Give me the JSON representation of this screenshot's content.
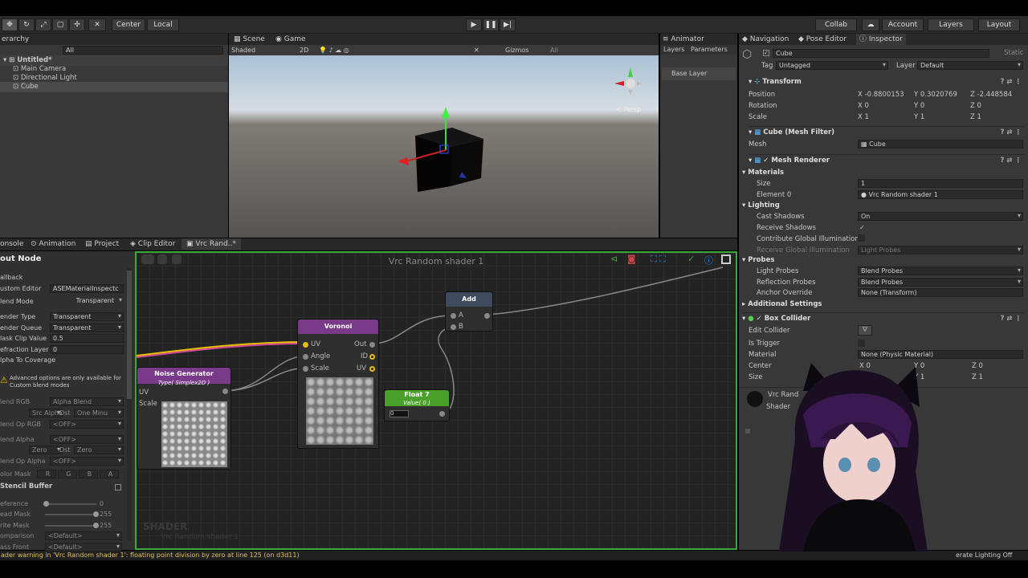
{
  "toolbar": {
    "pivot": "Center",
    "space": "Local",
    "collab": "Collab",
    "account": "Account",
    "layers": "Layers",
    "layout": "Layout"
  },
  "hierarchy": {
    "tab": "erarchy",
    "search": "All",
    "scene": "Untitled*",
    "items": [
      "Main Camera",
      "Directional Light",
      "Cube"
    ]
  },
  "scene": {
    "tabs": [
      "Scene",
      "Game"
    ],
    "shading": "Shaded",
    "mode2d": "2D",
    "gizmos": "Gizmos",
    "search": "All",
    "persp": "< Persp"
  },
  "animator": {
    "tab": "Animator",
    "sub_tabs": [
      "Layers",
      "Parameters"
    ],
    "layer": "Base Layer"
  },
  "bottom_tabs": [
    "onsole",
    "Animation",
    "Project",
    "Clip Editor",
    "Vrc Rand..*"
  ],
  "output_node": {
    "title": "out Node",
    "rows": [
      {
        "l": "allback",
        "v": ""
      },
      {
        "l": "ustom Editor",
        "v": "ASEMaterialInspectc"
      },
      {
        "l": "lend Mode",
        "v": "Transparent"
      },
      {
        "l": "ender Type",
        "v": "Transparent"
      },
      {
        "l": "ender Queue",
        "v": "Transparent"
      },
      {
        "l": "lask Clip Value",
        "v": "0.5"
      },
      {
        "l": "efraction Layer",
        "v": "0"
      },
      {
        "l": "lpha To Coverage",
        "v": ""
      }
    ],
    "warning": "Advanced options are only available for Custom blend modes",
    "blend_rows": [
      {
        "l": "lend RGB",
        "v": "Alpha Blend"
      },
      {
        "l": "Src",
        "v": "Src Alpha"
      },
      {
        "l": "Dst",
        "v": "One Minu"
      },
      {
        "l": "lend Op RGB",
        "v": "<OFF>"
      },
      {
        "l": "lend Alpha",
        "v": "<OFF>"
      },
      {
        "l": "Src",
        "v": "Zero"
      },
      {
        "l": "Dst",
        "v": "Zero"
      },
      {
        "l": "lend Op Alpha",
        "v": "<OFF>"
      }
    ],
    "color_mask": {
      "l": "olor Mask",
      "v": [
        "R",
        "G",
        "B",
        "A"
      ]
    },
    "stencil": "Stencil Buffer",
    "stencil_rows": [
      {
        "l": "eference",
        "v": "0"
      },
      {
        "l": "ead Mask",
        "v": "255"
      },
      {
        "l": "rite Mask",
        "v": "255"
      },
      {
        "l": "omparison",
        "v": "<Default>"
      },
      {
        "l": "ass Front",
        "v": "<Default>"
      }
    ]
  },
  "graph": {
    "title": "Vrc Random shader 1",
    "watermark": "SHADER",
    "watermark_sub": "Vrc Random shader 1",
    "nodes": {
      "noise": {
        "title": "Noise Generator",
        "sub": "Type( Simplex2D )",
        "in": "UV",
        "in2": "Scale"
      },
      "voronoi": {
        "title": "Voronoi",
        "ins": [
          "UV",
          "Angle",
          "Scale"
        ],
        "outs": [
          "Out",
          "ID",
          "UV"
        ]
      },
      "add": {
        "title": "Add",
        "ins": [
          "A",
          "B"
        ]
      },
      "float": {
        "title": "Float 7",
        "sub": "Value( 0 )",
        "value": "0"
      }
    }
  },
  "status": "ader warning in 'Vrc Random shader 1': floating point division by zero at line 125 (on d3d11)",
  "status_right": "erate Lighting Off",
  "inspector": {
    "tabs": [
      "Navigation",
      "Pose Editor",
      "Inspector"
    ],
    "name": "Cube",
    "static": "Static",
    "tag_label": "Tag",
    "tag": "Untagged",
    "layer_label": "Layer",
    "layer": "Default",
    "transform": {
      "title": "Transform",
      "rows": [
        {
          "l": "Position",
          "x": "-0.8800153",
          "y": "0.3020769",
          "z": "-2.448584"
        },
        {
          "l": "Rotation",
          "x": "0",
          "y": "0",
          "z": "0"
        },
        {
          "l": "Scale",
          "x": "1",
          "y": "1",
          "z": "1"
        }
      ]
    },
    "mesh_filter": {
      "title": "Cube (Mesh Filter)",
      "mesh_label": "Mesh",
      "mesh": "Cube"
    },
    "mesh_renderer": {
      "title": "Mesh Renderer",
      "materials": "Materials",
      "size_label": "Size",
      "size": "1",
      "element_label": "Element 0",
      "element": "Vrc Random shader 1",
      "lighting": "Lighting",
      "cast_label": "Cast Shadows",
      "cast": "On",
      "receive_label": "Receive Shadows",
      "gi_label": "Contribute Global Illumination",
      "rgi_label": "Receive Global Illumination",
      "rgi": "Light Probes",
      "probes": "Probes",
      "lp_label": "Light Probes",
      "lp": "Blend Probes",
      "rp_label": "Reflection Probes",
      "rp": "Blend Probes",
      "anchor_label": "Anchor Override",
      "anchor": "None (Transform)",
      "additional": "Additional Settings"
    },
    "box_collider": {
      "title": "Box Collider",
      "edit": "Edit Collider",
      "trigger": "Is Trigger",
      "material_label": "Material",
      "material": "None (Physic Material)",
      "center_label": "Center",
      "center": {
        "x": "0",
        "y": "0",
        "z": "0"
      },
      "size_label": "Size",
      "size": {
        "x": "1",
        "y": "1",
        "z": "1"
      }
    },
    "material": {
      "name": "Vrc Rand",
      "shader_label": "Shader"
    }
  }
}
